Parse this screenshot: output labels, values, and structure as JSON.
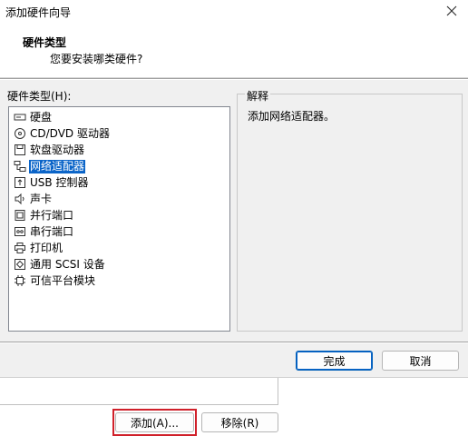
{
  "window": {
    "title": "添加硬件向导",
    "close_icon": "close-icon"
  },
  "header": {
    "title": "硬件类型",
    "subtitle": "您要安装哪类硬件?"
  },
  "hardware_list": {
    "label": "硬件类型(H):",
    "selected_index": 3,
    "items": [
      {
        "label": "硬盘",
        "icon": "hard-disk-icon"
      },
      {
        "label": "CD/DVD 驱动器",
        "icon": "cd-dvd-icon"
      },
      {
        "label": "软盘驱动器",
        "icon": "floppy-icon"
      },
      {
        "label": "网络适配器",
        "icon": "network-adapter-icon"
      },
      {
        "label": "USB 控制器",
        "icon": "usb-icon"
      },
      {
        "label": "声卡",
        "icon": "speaker-icon"
      },
      {
        "label": "并行端口",
        "icon": "parallel-port-icon"
      },
      {
        "label": "串行端口",
        "icon": "serial-port-icon"
      },
      {
        "label": "打印机",
        "icon": "printer-icon"
      },
      {
        "label": "通用 SCSI 设备",
        "icon": "scsi-icon"
      },
      {
        "label": "可信平台模块",
        "icon": "tpm-chip-icon"
      }
    ]
  },
  "explanation": {
    "legend": "解释",
    "text": "添加网络适配器。"
  },
  "buttons": {
    "finish": "完成",
    "cancel": "取消",
    "add": "添加(A)...",
    "remove": "移除(R)"
  },
  "colors": {
    "selection": "#0a64c8",
    "highlight_box": "#d0202a"
  }
}
